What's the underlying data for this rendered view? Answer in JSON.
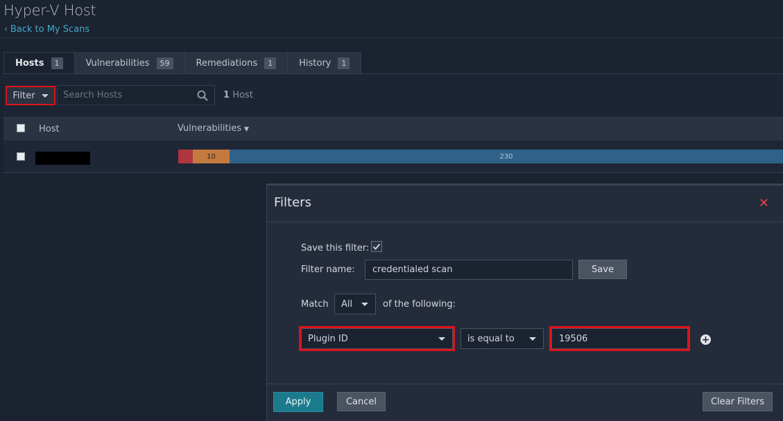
{
  "header": {
    "title": "Hyper-V Host",
    "back_label": "Back to My Scans"
  },
  "tabs": [
    {
      "label": "Hosts",
      "count": "1"
    },
    {
      "label": "Vulnerabilities",
      "count": "59"
    },
    {
      "label": "Remediations",
      "count": "1"
    },
    {
      "label": "History",
      "count": "1"
    }
  ],
  "toolbar": {
    "filter_label": "Filter",
    "search_placeholder": "Search Hosts",
    "host_count_number": "1",
    "host_count_word": "Host"
  },
  "table": {
    "col_host": "Host",
    "col_vulns": "Vulnerabilities",
    "rows": [
      {
        "vuln_bar": [
          {
            "severity": "critical",
            "value": "",
            "color": "#b0353f"
          },
          {
            "severity": "high",
            "value": "10",
            "color": "#c47a3e"
          },
          {
            "severity": "info",
            "value": "230",
            "color": "#2f6289"
          }
        ]
      }
    ]
  },
  "modal": {
    "title": "Filters",
    "save_filter_label": "Save this filter:",
    "save_filter_checked": true,
    "filter_name_label": "Filter name:",
    "filter_name_value": "credentialed scan",
    "save_button": "Save",
    "match_label": "Match",
    "match_value": "All",
    "match_suffix": "of the following:",
    "rule": {
      "field": "Plugin ID",
      "operator": "is equal to",
      "value": "19506"
    },
    "apply_button": "Apply",
    "cancel_button": "Cancel",
    "clear_button": "Clear Filters"
  },
  "colors": {
    "accent": "#44a9c8",
    "highlight_outline": "#e0121a",
    "close_red": "#e8434a"
  }
}
